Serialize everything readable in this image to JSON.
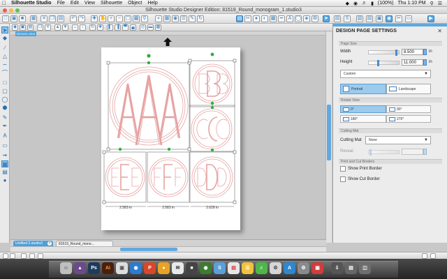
{
  "menubar": {
    "app_name": "Silhouette Studio",
    "items": [
      "File",
      "Edit",
      "View",
      "Silhouette",
      "Object",
      "Help"
    ],
    "battery": "(100%)",
    "clock": "Thu 1:10 PM"
  },
  "window": {
    "title": "Silhouette Studio Designer Edition: 81519_Round_monogram_1.studio3"
  },
  "canvas": {
    "view_badge": "DESIGN VIEW",
    "dimensions": [
      "2.583 in",
      "2.583 in",
      "2.628 in"
    ]
  },
  "panel": {
    "title": "DESIGN PAGE SETTINGS",
    "page_size": {
      "header": "Page Size",
      "width_label": "Width",
      "width_value": "8.500",
      "height_label": "Height",
      "height_value": "11.000",
      "unit": "in",
      "preset": "Custom"
    },
    "orientation": {
      "portrait": "Portrait",
      "landscape": "Landscape"
    },
    "rotate": {
      "header": "Rotate View",
      "options": [
        "0°",
        "90°",
        "180°",
        "270°"
      ]
    },
    "cutting_mat": {
      "header": "Cutting Mat",
      "label": "Cutting Mat",
      "value": "None",
      "reveal_label": "Reveal"
    },
    "print_cut": {
      "header": "Print and Cut Borders",
      "show_print_border": "Show Print Border",
      "show_cut_border": "Show Cut Border"
    }
  },
  "tabs": [
    {
      "label": "Untitled-2.studio3"
    },
    {
      "label": "81519_Round_mono..."
    }
  ],
  "colors": {
    "accent": "#4ba0dc",
    "monogram_stroke": "#e6a1a1",
    "handle_green": "#2fae3a"
  }
}
